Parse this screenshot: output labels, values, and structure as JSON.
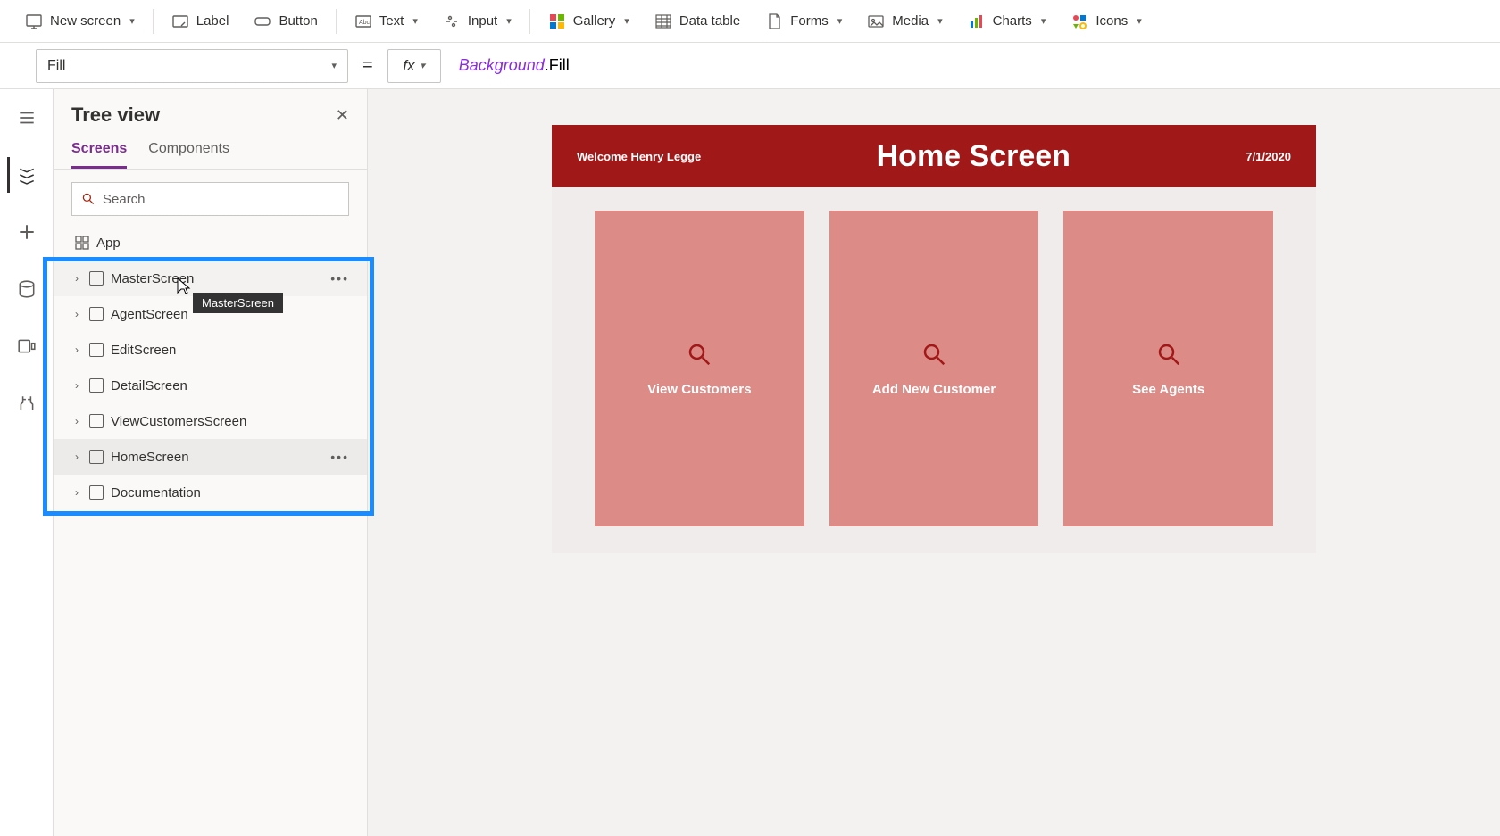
{
  "ribbon": {
    "new_screen": "New screen",
    "label": "Label",
    "button": "Button",
    "text": "Text",
    "input": "Input",
    "gallery": "Gallery",
    "data_table": "Data table",
    "forms": "Forms",
    "media": "Media",
    "charts": "Charts",
    "icons": "Icons"
  },
  "formula": {
    "property": "Fill",
    "fx": "fx",
    "expr_ident": "Background",
    "expr_prop": ".Fill"
  },
  "panel": {
    "title": "Tree view",
    "tabs": {
      "screens": "Screens",
      "components": "Components"
    },
    "search_placeholder": "Search",
    "app_node": "App",
    "screens": [
      {
        "name": "MasterScreen",
        "hover": true
      },
      {
        "name": "AgentScreen"
      },
      {
        "name": "EditScreen"
      },
      {
        "name": "DetailScreen"
      },
      {
        "name": "ViewCustomersScreen"
      },
      {
        "name": "HomeScreen",
        "selected": true
      },
      {
        "name": "Documentation"
      }
    ],
    "tooltip": "MasterScreen"
  },
  "canvas": {
    "welcome": "Welcome Henry Legge",
    "title": "Home Screen",
    "date": "7/1/2020",
    "tiles": [
      {
        "label": "View Customers"
      },
      {
        "label": "Add New Customer"
      },
      {
        "label": "See Agents"
      }
    ]
  }
}
